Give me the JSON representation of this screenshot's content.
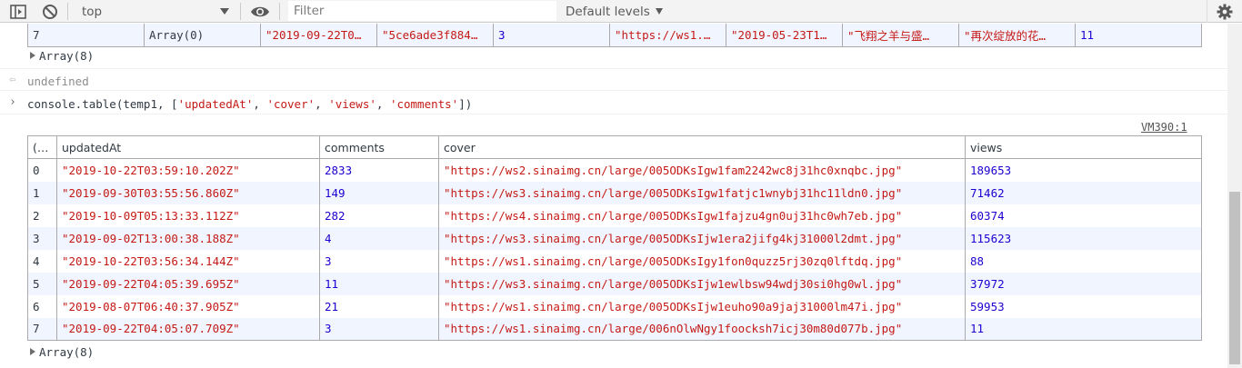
{
  "toolbar": {
    "context": "top",
    "filter_placeholder": "Filter",
    "levels": "Default levels"
  },
  "top_table": {
    "row": [
      "7",
      "Array(0)",
      "\"2019-09-22T0…",
      "\"5ce6ade3f884…",
      "3",
      "\"https://ws1.…",
      "\"2019-05-23T1…",
      "\"飞翔之羊与盛…",
      "\"再次绽放的花…",
      "11"
    ]
  },
  "array_label": "Array(8)",
  "undefined_text": "undefined",
  "command": {
    "prefix": "console.table(temp1, [",
    "arg1": "'updatedAt'",
    "arg2": "'cover'",
    "arg3": "'views'",
    "arg4": "'comments'",
    "sep": ", ",
    "suffix": "])"
  },
  "source_link": "VM390:1",
  "table": {
    "headers": [
      "(…",
      "updatedAt",
      "comments",
      "cover",
      "views"
    ],
    "rows": [
      [
        "0",
        "\"2019-10-22T03:59:10.202Z\"",
        "2833",
        "\"https://ws2.sinaimg.cn/large/005ODKsIgw1fam2242wc8j31hc0xnqbc.jpg\"",
        "189653"
      ],
      [
        "1",
        "\"2019-09-30T03:55:56.860Z\"",
        "149",
        "\"https://ws3.sinaimg.cn/large/005ODKsIgw1fatjc1wnybj31hc11ldn0.jpg\"",
        "71462"
      ],
      [
        "2",
        "\"2019-10-09T05:13:33.112Z\"",
        "282",
        "\"https://ws4.sinaimg.cn/large/005ODKsIgw1fajzu4gn0uj31hc0wh7eb.jpg\"",
        "60374"
      ],
      [
        "3",
        "\"2019-09-02T13:00:38.188Z\"",
        "4",
        "\"https://ws3.sinaimg.cn/large/005ODKsIjw1era2jifg4kj31000l2dmt.jpg\"",
        "115623"
      ],
      [
        "4",
        "\"2019-10-22T03:56:34.144Z\"",
        "3",
        "\"https://ws1.sinaimg.cn/large/005ODKsIgy1fon0quzz5rj30zq0lftdq.jpg\"",
        "88"
      ],
      [
        "5",
        "\"2019-09-22T04:05:39.695Z\"",
        "11",
        "\"https://ws3.sinaimg.cn/large/005ODKsIjw1ewlbsw94wdj30si0hg0wl.jpg\"",
        "37972"
      ],
      [
        "6",
        "\"2019-08-07T06:40:37.905Z\"",
        "21",
        "\"https://ws1.sinaimg.cn/large/005ODKsIjw1euho90a9jaj31000lm47i.jpg\"",
        "59953"
      ],
      [
        "7",
        "\"2019-09-22T04:05:07.709Z\"",
        "3",
        "\"https://ws1.sinaimg.cn/large/006nOlwNgy1foocksh7icj30m80d077b.jpg\"",
        "11"
      ]
    ]
  },
  "colors": {
    "string": "#c41a16",
    "number": "#1c00cf",
    "row_alt": "#f1f5ff"
  }
}
